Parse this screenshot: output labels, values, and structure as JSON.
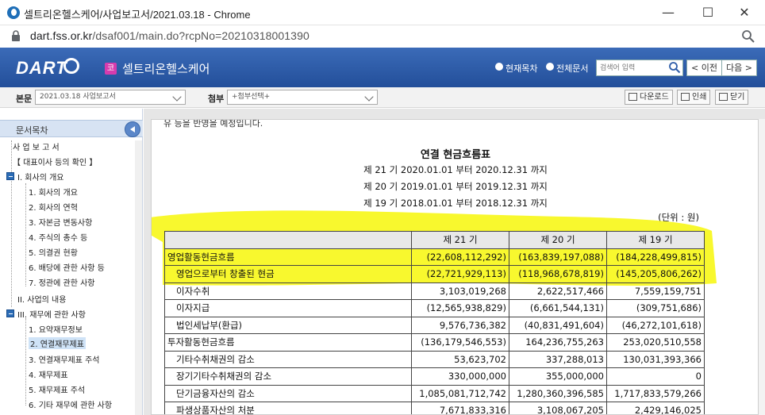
{
  "browser": {
    "window_title": "셀트리온헬스케어/사업보고서/2021.03.18 - Chrome",
    "url_host": "dart.fss.or.kr",
    "url_path": "/dsaf001/main.do?rcpNo=20210318001390",
    "controls": {
      "minimize": "—",
      "maximize": "☐",
      "close": "✕"
    }
  },
  "dart_header": {
    "logo": "DART",
    "company_badge": "코",
    "company_name": "셀트리온헬스케어",
    "radio_current": "현재목차",
    "radio_all": "전체문서",
    "search_placeholder": "검색어 입력",
    "prev_label": "< 이전",
    "next_label": "다음 >"
  },
  "toolbar": {
    "main_label": "본문",
    "main_select": "2021.03.18  사업보고서",
    "attach_label": "첨부",
    "attach_select": "+첨부선택+",
    "download_label": "다운로드",
    "print_label": "인쇄",
    "close_label": "닫기"
  },
  "toc": {
    "title": "문서목차",
    "items": [
      "사 업 보 고 서",
      "【 대표이사 등의 확인 】",
      "I. 회사의 개요",
      "1. 회사의 개요",
      "2. 회사의 연혁",
      "3. 자본금 변동사항",
      "4. 주식의 총수 등",
      "5. 의결권 현황",
      "6. 배당에 관한 사항 등",
      "7. 정관에 관한 사항",
      "II. 사업의 내용",
      "III. 재무에 관한 사항",
      "1. 요약재무정보",
      "2. 연결재무제표",
      "3. 연결재무제표 주석",
      "4. 재무제표",
      "5. 재무제표 주석",
      "6. 기타 재무에 관한 사항"
    ]
  },
  "document": {
    "cut_text": "유 등을 반영을 예정입니다.",
    "title": "연결 현금흐름표",
    "periods": [
      "제 21 기 2020.01.01 부터 2020.12.31 까지",
      "제 20 기 2019.01.01 부터 2019.12.31 까지",
      "제 19 기 2018.01.01 부터 2018.12.31 까지"
    ],
    "unit": "(단위 : 원)",
    "columns": [
      "",
      "제 21 기",
      "제 20 기",
      "제 19 기"
    ],
    "rows": [
      {
        "label": "영업활동현금흐름",
        "level": 0,
        "v21": "(22,608,112,292)",
        "v20": "(163,839,197,088)",
        "v19": "(184,228,499,815)"
      },
      {
        "label": "영업으로부터 창출된 현금",
        "level": 1,
        "v21": "(22,721,929,113)",
        "v20": "(118,968,678,819)",
        "v19": "(145,205,806,262)"
      },
      {
        "label": "이자수취",
        "level": 1,
        "v21": "3,103,019,268",
        "v20": "2,622,517,466",
        "v19": "7,559,159,751"
      },
      {
        "label": "이자지급",
        "level": 1,
        "v21": "(12,565,938,829)",
        "v20": "(6,661,544,131)",
        "v19": "(309,751,686)"
      },
      {
        "label": "법인세납부(환급)",
        "level": 1,
        "v21": "9,576,736,382",
        "v20": "(40,831,491,604)",
        "v19": "(46,272,101,618)"
      },
      {
        "label": "투자활동현금흐름",
        "level": 0,
        "v21": "(136,179,546,553)",
        "v20": "164,236,755,263",
        "v19": "253,020,510,558"
      },
      {
        "label": "기타수취채권의 감소",
        "level": 1,
        "v21": "53,623,702",
        "v20": "337,288,013",
        "v19": "130,031,393,366"
      },
      {
        "label": "장기기타수취채권의 감소",
        "level": 1,
        "v21": "330,000,000",
        "v20": "355,000,000",
        "v19": "0"
      },
      {
        "label": "단기금융자산의 감소",
        "level": 1,
        "v21": "1,085,081,712,742",
        "v20": "1,280,360,396,585",
        "v19": "1,717,833,579,266"
      },
      {
        "label": "파생상품자산의 처분",
        "level": 1,
        "v21": "7,671,833,316",
        "v20": "3,108,067,205",
        "v19": "2,429,146,025"
      }
    ]
  },
  "colors": {
    "header_blue": "#2f5ea9",
    "highlight": "#f5f500",
    "toc_selected": "#cfe3f7"
  }
}
